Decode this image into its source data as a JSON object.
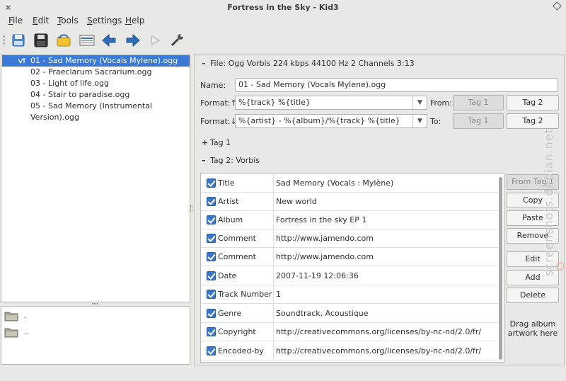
{
  "window": {
    "title": "Fortress in the Sky - Kid3",
    "close_glyph": "×"
  },
  "menu": [
    {
      "label": "File",
      "mnemonic": "F",
      "rest": "ile"
    },
    {
      "label": "Edit",
      "mnemonic": "E",
      "rest": "dit"
    },
    {
      "label": "Tools",
      "mnemonic": "T",
      "rest": "ools"
    },
    {
      "label": "Settings",
      "mnemonic": "S",
      "rest": "ettings"
    },
    {
      "label": "Help",
      "mnemonic": "H",
      "rest": "elp"
    }
  ],
  "toolbar": {
    "icons": [
      "new-icon",
      "save-icon",
      "revert-icon",
      "create-playlist-icon",
      "previous-icon",
      "next-icon",
      "play-icon",
      "settings-wrench-icon"
    ]
  },
  "files": [
    "01 - Sad Memory (Vocals Mylene).ogg",
    "02 - Praeclarum Sacrarium.ogg",
    "03 - Light of life.ogg",
    "04 - Stair to paradise.ogg",
    "05 - Sad Memory (Instrumental Version).ogg"
  ],
  "selected_file_index": 0,
  "dirs": [
    ".",
    ".."
  ],
  "file_section": {
    "toggle": "–",
    "label": "File: Ogg Vorbis 224 kbps 44100 Hz 2 Channels 3:13"
  },
  "name_field": {
    "label": "Name:",
    "value": "01 - Sad Memory (Vocals Mylene).ogg"
  },
  "format_up": {
    "label": "Format:↑",
    "value": "%{track} %{title}",
    "from_label": "From:",
    "tag1": "Tag 1",
    "tag2": "Tag 2"
  },
  "format_down": {
    "label": "Format:↓",
    "value": "%{artist} - %{album}/%{track} %{title}",
    "to_label": "To:",
    "tag1": "Tag 1",
    "tag2": "Tag 2"
  },
  "tag1_section": {
    "toggle": "+",
    "label": "Tag 1"
  },
  "tag2_section": {
    "toggle": "–",
    "label": "Tag 2: Vorbis"
  },
  "tag2_frames": [
    {
      "name": "Title",
      "value": "Sad Memory (Vocals : Mylène)"
    },
    {
      "name": "Artist",
      "value": "New world"
    },
    {
      "name": "Album",
      "value": "Fortress in the sky EP 1"
    },
    {
      "name": "Comment",
      "value": "http://www.jamendo.com"
    },
    {
      "name": "Comment",
      "value": "http://www.jamendo.com"
    },
    {
      "name": "Date",
      "value": "2007-11-19 12:06:36"
    },
    {
      "name": "Track Number",
      "value": "1"
    },
    {
      "name": "Genre",
      "value": "Soundtrack, Acoustique"
    },
    {
      "name": "Copyright",
      "value": "http://creativecommons.org/licenses/by-nc-nd/2.0/fr/"
    },
    {
      "name": "Encoded-by",
      "value": "http://creativecommons.org/licenses/by-nc-nd/2.0/fr/"
    }
  ],
  "tag2_buttons": {
    "from_tag1": "From Tag 1",
    "copy": "Copy",
    "paste": "Paste",
    "remove": "Remove",
    "edit": "Edit",
    "add": "Add",
    "delete": "Delete"
  },
  "drag_artwork": "Drag album artwork here",
  "watermark": "screenshots.debian.net",
  "colors": {
    "selection": "#3b79d6",
    "checkbox": "#3d78c8"
  }
}
